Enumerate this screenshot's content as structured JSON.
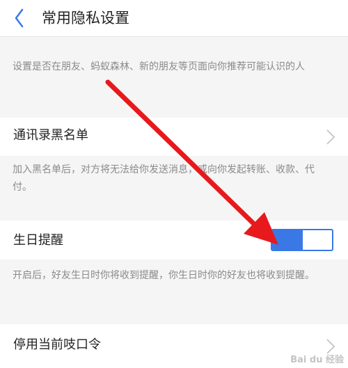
{
  "header": {
    "title": "常用隐私设置",
    "back_icon": "chevron-left-icon",
    "accent_color": "#3a78e6"
  },
  "sections": {
    "recommend_desc": "设置是否在朋友、蚂蚁森林、新的朋友等页面向你推荐可能认识的人",
    "blacklist": {
      "label": "通讯录黑名单",
      "desc": "加入黑名单后，对方将无法给你发送消息，或向你发起转账、收款、代付。"
    },
    "birthday": {
      "label": "生日提醒",
      "enabled": true,
      "desc": "开启后，好友生日时你将收到提醒，你生日时你的好友也将收到提醒。"
    },
    "password_command": {
      "label": "停用当前吱口令"
    }
  },
  "annotation": {
    "arrow_color": "#e8191c"
  },
  "watermark": {
    "text": "Bai du 经验"
  }
}
